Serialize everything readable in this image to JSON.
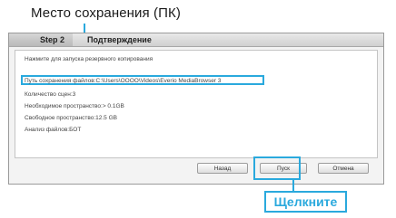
{
  "callout_save_location": "Место сохранения (ПК)",
  "callout_click": "Щелкните",
  "dialog": {
    "step_label": "Step 2",
    "title": "Подтверждение",
    "intro": "Нажмите для запуска резервного копирования",
    "save_path": "Путь сохранения файлов:C:\\Users\\OOOO\\Videos\\Everio MediaBrowser 3",
    "scene_count": "Количество сцен:3",
    "required_space": "Необходимое пространство:> 0.1GB",
    "free_space": "Свободное пространство:12.5 GB",
    "file_analysis": "Анализ файлов:БОТ"
  },
  "buttons": {
    "back": "Назад",
    "start": "Пуск",
    "cancel": "Отмена"
  },
  "colors": {
    "callout_accent": "#2aa9dd"
  }
}
